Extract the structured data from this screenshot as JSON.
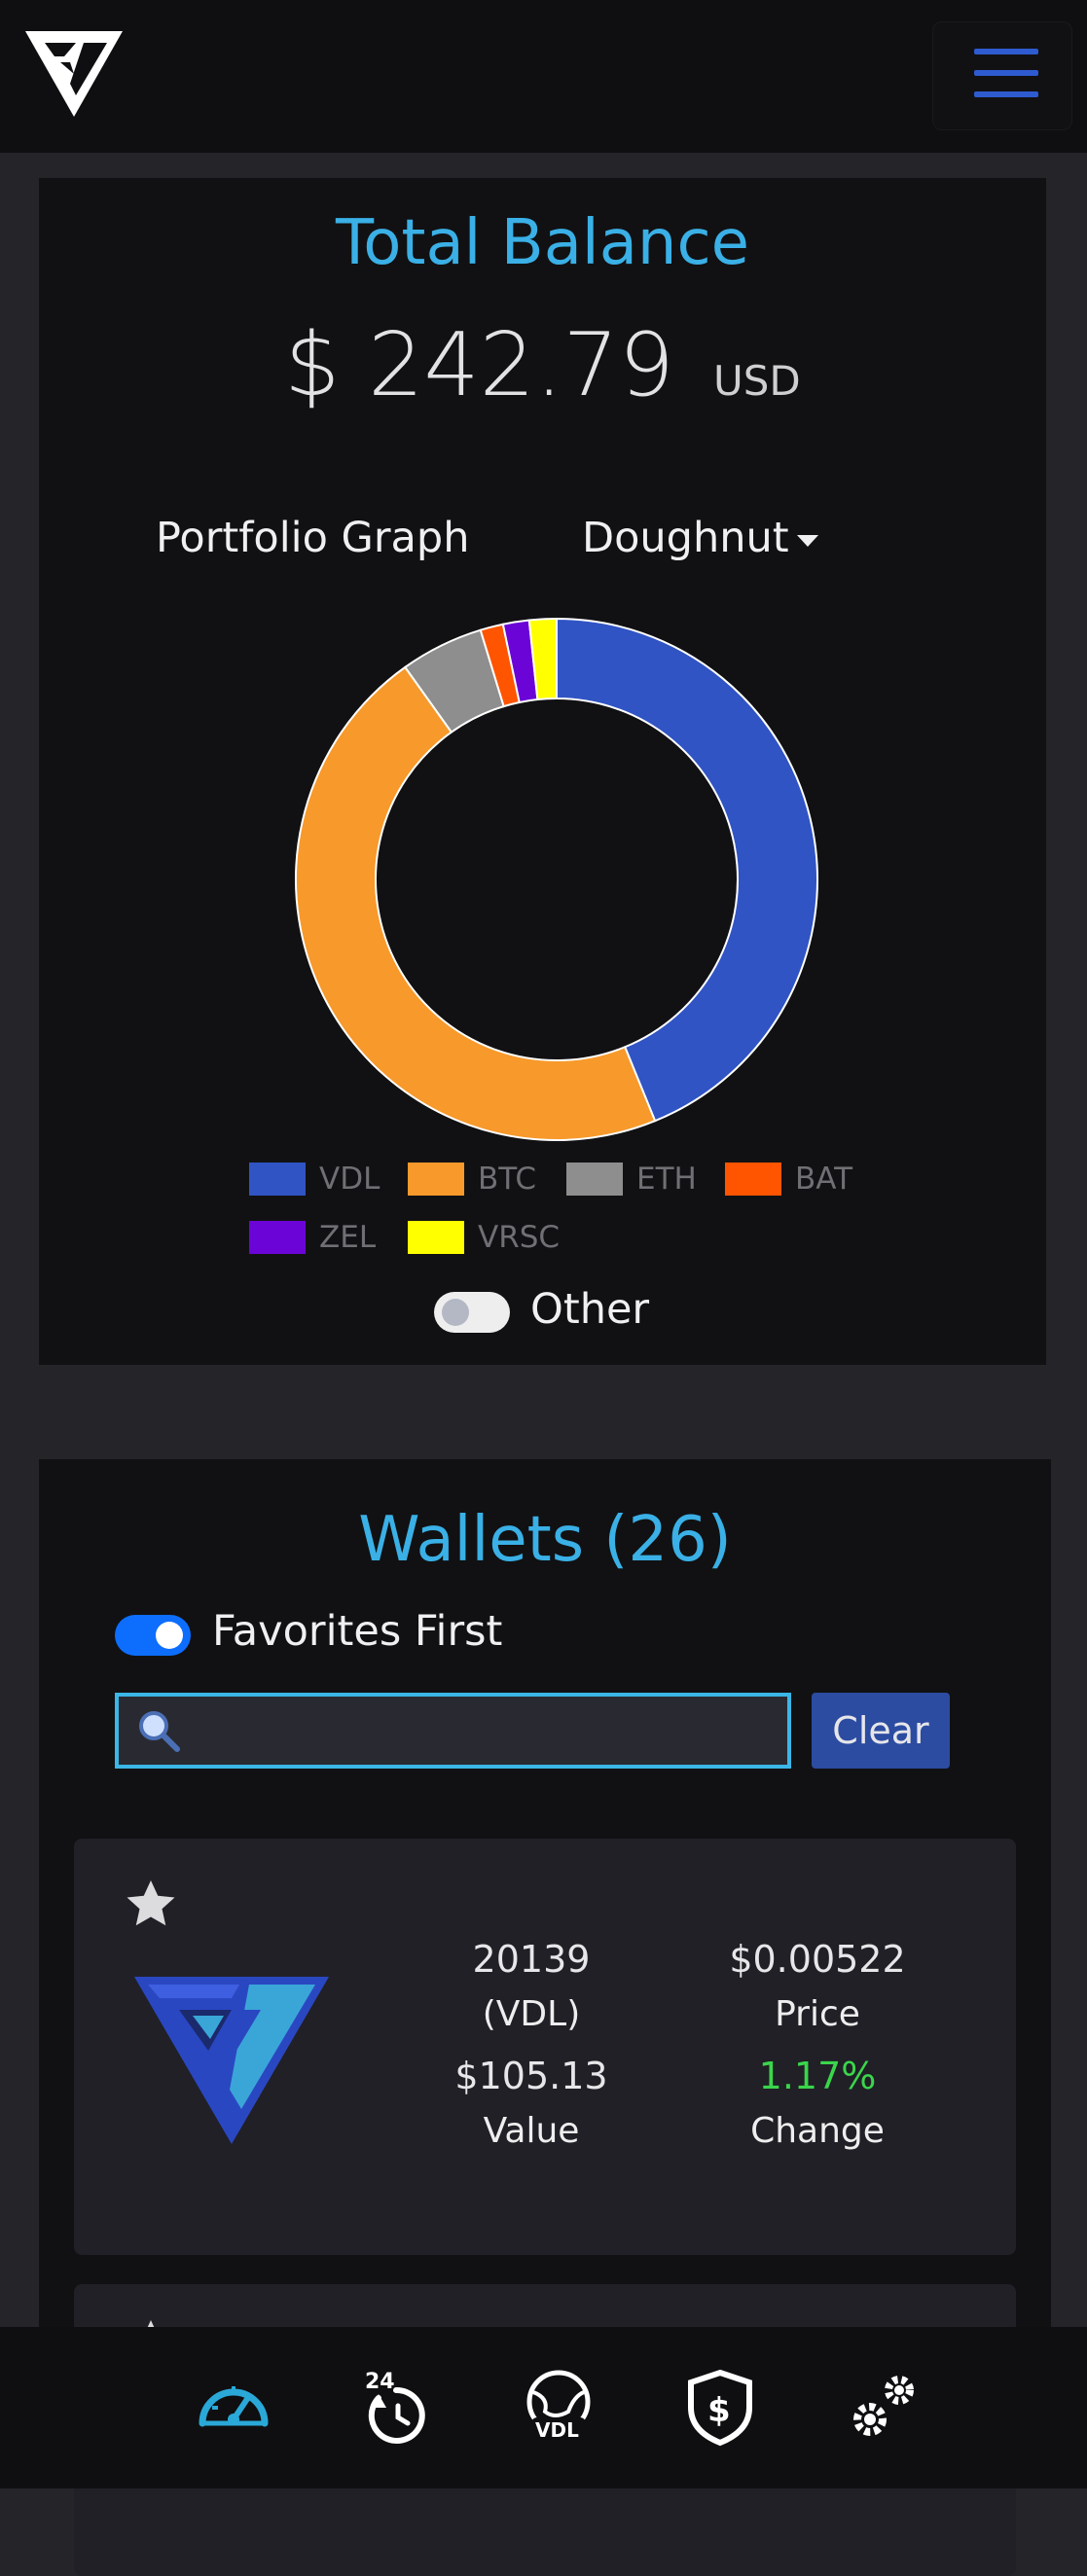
{
  "header": {
    "logo_icon": "vdl-logo-icon",
    "menu_icon": "hamburger-menu-icon"
  },
  "balance": {
    "title": "Total Balance",
    "amount": "$ 242.79",
    "currency": "USD",
    "graph_label": "Portfolio Graph",
    "graph_type": "Doughnut",
    "other_label": "Other",
    "other_toggle": false
  },
  "chart_data": {
    "type": "pie",
    "variant": "doughnut",
    "categories": [
      "VDL",
      "BTC",
      "ETH",
      "BAT",
      "ZEL",
      "VRSC"
    ],
    "values": [
      105.13,
      111.0,
      12.35,
      3.4,
      3.88,
      4.03
    ],
    "colors": [
      "#3054c4",
      "#f7992b",
      "#8e8e8e",
      "#ff5500",
      "#6b05d7",
      "#ffff00"
    ],
    "legend": [
      "VDL",
      "BTC",
      "ETH",
      "BAT",
      "ZEL",
      "VRSC"
    ],
    "legend_position": "bottom"
  },
  "wallets": {
    "title": "Wallets (26)",
    "favorites_label": "Favorites First",
    "favorites_toggle": true,
    "search_placeholder": "",
    "search_value": "",
    "clear_label": "Clear",
    "items": [
      {
        "favorite_icon": "star-icon",
        "coin_icon": "vdl-coin-icon",
        "balance": "20139",
        "symbol": "(VDL)",
        "price": "$0.00522",
        "price_label": "Price",
        "value": "$105.13",
        "value_label": "Value",
        "change": "1.17%",
        "change_label": "Change",
        "change_color": "#3bd54b"
      }
    ]
  },
  "bottom_nav": [
    {
      "icon": "dashboard-speedometer-icon",
      "active": true
    },
    {
      "icon": "24h-history-icon",
      "active": false
    },
    {
      "icon": "vdl-globe-icon",
      "active": false
    },
    {
      "icon": "shield-dollar-icon",
      "active": false
    },
    {
      "icon": "settings-gears-icon",
      "active": false
    }
  ]
}
